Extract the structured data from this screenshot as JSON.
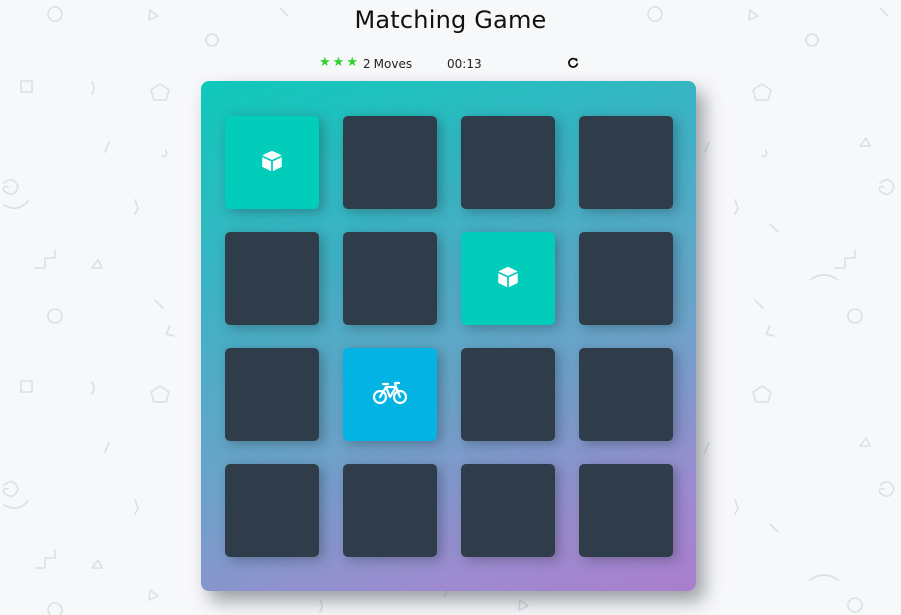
{
  "title": "Matching Game",
  "score_panel": {
    "stars": [
      {
        "state": "full",
        "icon": "star-icon",
        "color": "#2ed12e"
      },
      {
        "state": "full",
        "icon": "star-icon",
        "color": "#2ed12e"
      },
      {
        "state": "full",
        "icon": "star-icon",
        "color": "#2ed12e"
      }
    ],
    "moves": "2",
    "moves_label": "Moves",
    "timer": "00:13",
    "restart_icon": "restart-icon"
  },
  "colors": {
    "background": "#f7f8fa",
    "card_back": "#2e3d49",
    "card_match": "#02ccba",
    "card_open": "#02b3e4",
    "star": "#2ed12e",
    "deck_gradient_start": "#0ec9b9",
    "deck_gradient_end": "#aa7ecd"
  },
  "deck": {
    "rows": 4,
    "cols": 4,
    "cards": [
      {
        "state": "match",
        "icon": "cube-icon"
      },
      {
        "state": "closed",
        "icon": ""
      },
      {
        "state": "closed",
        "icon": ""
      },
      {
        "state": "closed",
        "icon": ""
      },
      {
        "state": "closed",
        "icon": ""
      },
      {
        "state": "closed",
        "icon": ""
      },
      {
        "state": "match",
        "icon": "cube-icon"
      },
      {
        "state": "closed",
        "icon": ""
      },
      {
        "state": "closed",
        "icon": ""
      },
      {
        "state": "open",
        "icon": "bicycle-icon"
      },
      {
        "state": "closed",
        "icon": ""
      },
      {
        "state": "closed",
        "icon": ""
      },
      {
        "state": "closed",
        "icon": ""
      },
      {
        "state": "closed",
        "icon": ""
      },
      {
        "state": "closed",
        "icon": ""
      },
      {
        "state": "closed",
        "icon": ""
      }
    ]
  }
}
